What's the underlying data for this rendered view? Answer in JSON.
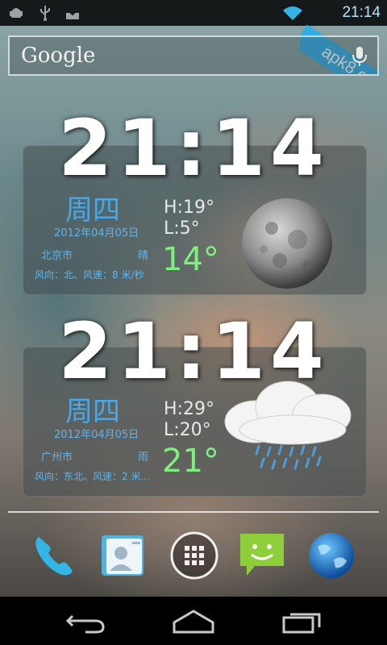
{
  "status_bar": {
    "time": "21:14",
    "icons": [
      "android-debug-icon",
      "usb-icon",
      "download-icon",
      "wifi-icon"
    ]
  },
  "watermark": {
    "text": "apk8.com"
  },
  "search": {
    "label": "Google"
  },
  "widgets": [
    {
      "time": "21:14",
      "weekday": "周四",
      "date": "2012年04月05日",
      "city": "北京市",
      "condition": "晴",
      "wind": "风向：北、风速：8 米/秒",
      "high": "H:19°",
      "low": "L:5°",
      "current": "14°",
      "icon": "moon-icon"
    },
    {
      "time": "21:14",
      "weekday": "周四",
      "date": "2012年04月05日",
      "city": "广州市",
      "condition": "雨",
      "wind": "风向：东北、风速：2 米...",
      "high": "H:29°",
      "low": "L:20°",
      "current": "21°",
      "icon": "rain-cloud-icon"
    }
  ],
  "dock": [
    "phone-icon",
    "contacts-icon",
    "app-drawer-icon",
    "messaging-icon",
    "browser-icon"
  ],
  "navigation": [
    "back-icon",
    "home-icon",
    "recent-apps-icon"
  ],
  "colors": {
    "accent_blue": "#4aa8e8",
    "temp_green": "#7ef07e",
    "watermark_blue": "#2eaee8"
  }
}
